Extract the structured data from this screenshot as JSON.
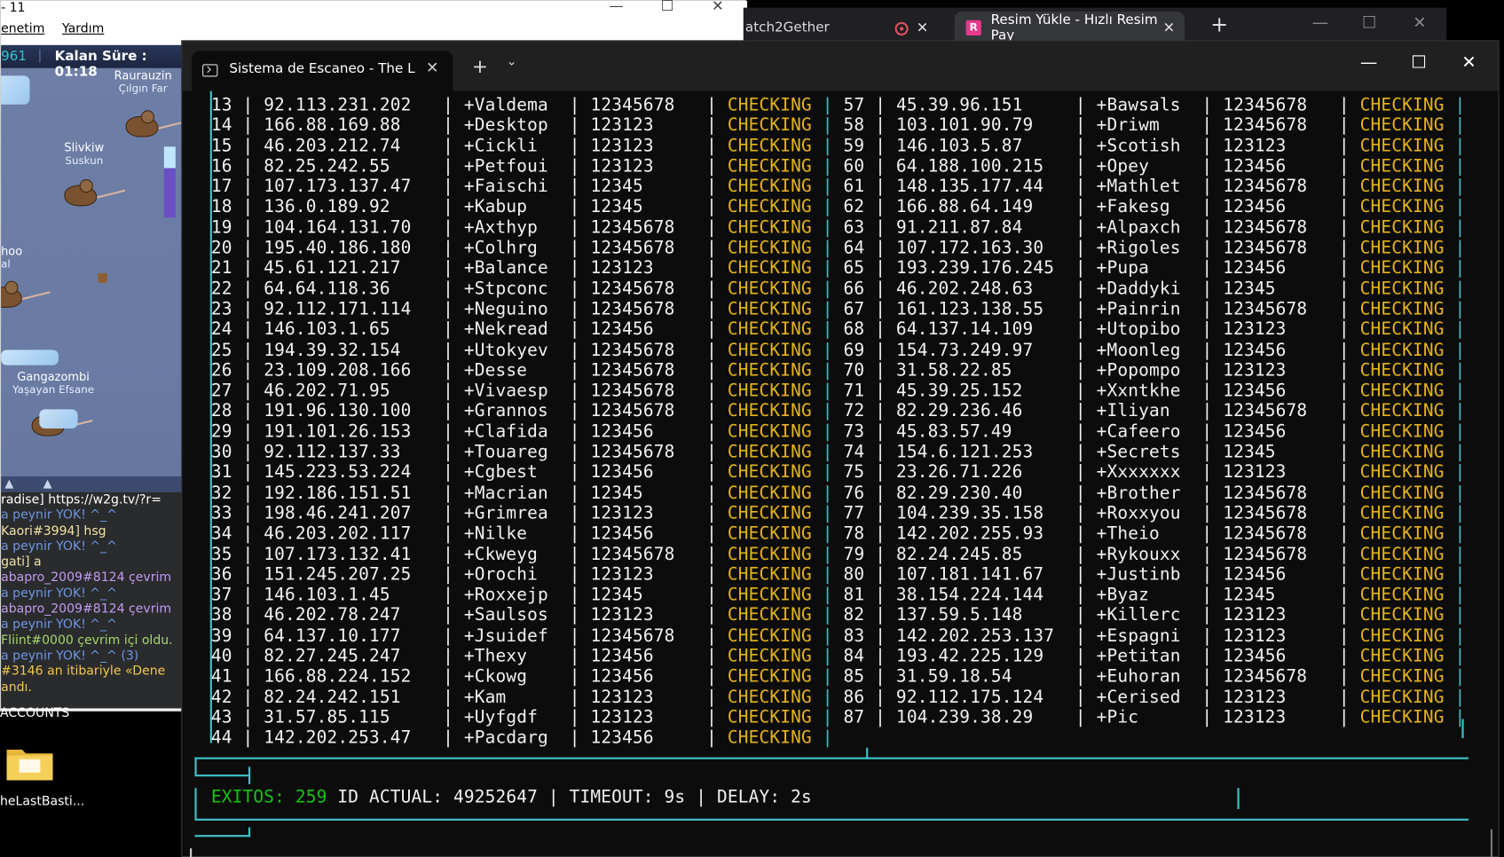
{
  "game": {
    "title_fragment": "- 11",
    "menu": [
      "enetim",
      "Yardım"
    ],
    "hud_num": "961",
    "hud_time": "Kalan Süre : 01:18",
    "players": [
      {
        "name": "Raurauzin",
        "sub": "Çılgın Far"
      },
      {
        "name": "Slivkiw",
        "sub": "Suskun"
      },
      {
        "name": "hoo",
        "sub": "al"
      },
      {
        "name": "Gangazombi",
        "sub": "Yaşayan Efsane"
      }
    ],
    "chat": [
      {
        "text": "radise] https://w2g.tv/?r=",
        "color": "c-wht"
      },
      {
        "text": "a peynir YOK! ^_^",
        "color": "c-blu"
      },
      {
        "text": "Kaori#3994] hsg",
        "color": "c-cream"
      },
      {
        "text": "a peynir YOK! ^_^",
        "color": "c-blu"
      },
      {
        "text": "gati] a",
        "color": "c-cream"
      },
      {
        "text": "abapro_2009#8124 çevrim",
        "color": "c-pur"
      },
      {
        "text": "a peynir YOK! ^_^",
        "color": "c-blu"
      },
      {
        "text": "abapro_2009#8124 çevrim",
        "color": "c-pur"
      },
      {
        "text": "a peynir YOK! ^_^",
        "color": "c-blu"
      },
      {
        "text": "Fliint#0000 çevrim içi oldu.",
        "color": "c-grn"
      },
      {
        "text": "a peynir YOK! ^_^ (3)",
        "color": "c-blu"
      },
      {
        "text": "#3146 an itibariyle «Dene",
        "color": "c-yel"
      },
      {
        "text": "andı.",
        "color": "c-yel"
      }
    ]
  },
  "desktop": {
    "accounts_label": "ACCOUNTS",
    "folder_label": "heLastBasti..."
  },
  "browser": {
    "tab1": "atch2Gether",
    "tab2": "Resim Yükle - Hızlı Resim Pay",
    "new_tab": "+"
  },
  "terminal": {
    "title": "Sistema de Escaneo - The Last Bastion",
    "rows": [
      [
        "13",
        "92.113.231.202",
        "+Valdema",
        "12345678",
        "CHECKING",
        "57",
        "45.39.96.151",
        "+Bawsals",
        "12345678",
        "CHECKING"
      ],
      [
        "14",
        "166.88.169.88",
        "+Desktop",
        "123123",
        "CHECKING",
        "58",
        "103.101.90.79",
        "+Driwm",
        "12345678",
        "CHECKING"
      ],
      [
        "15",
        "46.203.212.74",
        "+Cickli",
        "123123",
        "CHECKING",
        "59",
        "146.103.5.87",
        "+Scotish",
        "123123",
        "CHECKING"
      ],
      [
        "16",
        "82.25.242.55",
        "+Petfoui",
        "123123",
        "CHECKING",
        "60",
        "64.188.100.215",
        "+Opey",
        "123456",
        "CHECKING"
      ],
      [
        "17",
        "107.173.137.47",
        "+Faischi",
        "12345",
        "CHECKING",
        "61",
        "148.135.177.44",
        "+Mathlet",
        "12345678",
        "CHECKING"
      ],
      [
        "18",
        "136.0.189.92",
        "+Kabup",
        "12345",
        "CHECKING",
        "62",
        "166.88.64.149",
        "+Fakesg",
        "123456",
        "CHECKING"
      ],
      [
        "19",
        "104.164.131.70",
        "+Axthyp",
        "12345678",
        "CHECKING",
        "63",
        "91.211.87.84",
        "+Alpaxch",
        "12345678",
        "CHECKING"
      ],
      [
        "20",
        "195.40.186.180",
        "+Colhrg",
        "12345678",
        "CHECKING",
        "64",
        "107.172.163.30",
        "+Rigoles",
        "12345678",
        "CHECKING"
      ],
      [
        "21",
        "45.61.121.217",
        "+Balance",
        "123123",
        "CHECKING",
        "65",
        "193.239.176.245",
        "+Pupa",
        "123456",
        "CHECKING"
      ],
      [
        "22",
        "64.64.118.36",
        "+Stpconc",
        "12345678",
        "CHECKING",
        "66",
        "46.202.248.63",
        "+Daddyki",
        "12345",
        "CHECKING"
      ],
      [
        "23",
        "92.112.171.114",
        "+Neguino",
        "12345678",
        "CHECKING",
        "67",
        "161.123.138.55",
        "+Painrin",
        "12345678",
        "CHECKING"
      ],
      [
        "24",
        "146.103.1.65",
        "+Nekread",
        "123456",
        "CHECKING",
        "68",
        "64.137.14.109",
        "+Utopibo",
        "123123",
        "CHECKING"
      ],
      [
        "25",
        "194.39.32.154",
        "+Utokyev",
        "12345678",
        "CHECKING",
        "69",
        "154.73.249.97",
        "+Moonleg",
        "123456",
        "CHECKING"
      ],
      [
        "26",
        "23.109.208.166",
        "+Desse",
        "12345678",
        "CHECKING",
        "70",
        "31.58.22.85",
        "+Popompo",
        "123123",
        "CHECKING"
      ],
      [
        "27",
        "46.202.71.95",
        "+Vivaesp",
        "12345678",
        "CHECKING",
        "71",
        "45.39.25.152",
        "+Xxntkhe",
        "123456",
        "CHECKING"
      ],
      [
        "28",
        "191.96.130.100",
        "+Grannos",
        "12345678",
        "CHECKING",
        "72",
        "82.29.236.46",
        "+Iliyan",
        "12345678",
        "CHECKING"
      ],
      [
        "29",
        "191.101.26.153",
        "+Clafida",
        "123456",
        "CHECKING",
        "73",
        "45.83.57.49",
        "+Cafeero",
        "123456",
        "CHECKING"
      ],
      [
        "30",
        "92.112.137.33",
        "+Touareg",
        "12345678",
        "CHECKING",
        "74",
        "154.6.121.253",
        "+Secrets",
        "12345",
        "CHECKING"
      ],
      [
        "31",
        "145.223.53.224",
        "+Cgbest",
        "123456",
        "CHECKING",
        "75",
        "23.26.71.226",
        "+Xxxxxxx",
        "123123",
        "CHECKING"
      ],
      [
        "32",
        "192.186.151.51",
        "+Macrian",
        "12345",
        "CHECKING",
        "76",
        "82.29.230.40",
        "+Brother",
        "12345678",
        "CHECKING"
      ],
      [
        "33",
        "198.46.241.207",
        "+Grimrea",
        "123123",
        "CHECKING",
        "77",
        "104.239.35.158",
        "+Roxxyou",
        "12345678",
        "CHECKING"
      ],
      [
        "34",
        "46.203.202.117",
        "+Nilke",
        "123456",
        "CHECKING",
        "78",
        "142.202.255.93",
        "+Theio",
        "12345678",
        "CHECKING"
      ],
      [
        "35",
        "107.173.132.41",
        "+Ckweyg",
        "12345678",
        "CHECKING",
        "79",
        "82.24.245.85",
        "+Rykouxx",
        "12345678",
        "CHECKING"
      ],
      [
        "36",
        "151.245.207.25",
        "+Orochi",
        "123123",
        "CHECKING",
        "80",
        "107.181.141.67",
        "+Justinb",
        "123456",
        "CHECKING"
      ],
      [
        "37",
        "146.103.1.45",
        "+Roxxejp",
        "12345",
        "CHECKING",
        "81",
        "38.154.224.144",
        "+Byaz",
        "12345",
        "CHECKING"
      ],
      [
        "38",
        "46.202.78.247",
        "+Saulsos",
        "123123",
        "CHECKING",
        "82",
        "137.59.5.148",
        "+Killerc",
        "123123",
        "CHECKING"
      ],
      [
        "39",
        "64.137.10.177",
        "+Jsuidef",
        "12345678",
        "CHECKING",
        "83",
        "142.202.253.137",
        "+Espagni",
        "123123",
        "CHECKING"
      ],
      [
        "40",
        "82.27.245.247",
        "+Thexy",
        "123456",
        "CHECKING",
        "84",
        "193.42.225.129",
        "+Petitan",
        "123456",
        "CHECKING"
      ],
      [
        "41",
        "166.88.224.152",
        "+Ckowg",
        "123456",
        "CHECKING",
        "85",
        "31.59.18.54",
        "+Euhoran",
        "12345678",
        "CHECKING"
      ],
      [
        "42",
        "82.24.242.151",
        "+Kam",
        "123123",
        "CHECKING",
        "86",
        "92.112.175.124",
        "+Cerised",
        "123123",
        "CHECKING"
      ],
      [
        "43",
        "31.57.85.115",
        "+Uyfgdf",
        "123123",
        "CHECKING",
        "87",
        "104.239.38.29",
        "+Pic",
        "123123",
        "CHECKING"
      ],
      [
        "44",
        "142.202.253.47",
        "+Pacdarg",
        "123456",
        "CHECKING"
      ]
    ],
    "status": {
      "exitos_label": "EXITOS:",
      "exitos_value": "259",
      "rest": " ID ACTUAL: 49252647 | TIMEOUT: 9s | DELAY: 2s"
    }
  },
  "colors": {
    "checking": "#e7b416",
    "border": "#3fc1c9",
    "success": "#16c60c"
  }
}
